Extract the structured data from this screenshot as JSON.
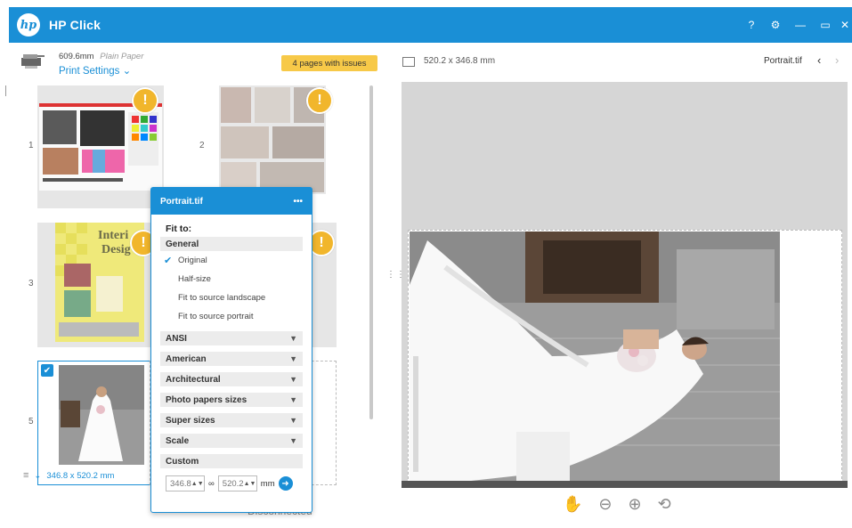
{
  "window": {
    "logo": "hp",
    "title": "HP Click",
    "controls": {
      "help": "?",
      "settings": "⚙",
      "minimize": "—",
      "maximize": "▭",
      "close": "✕"
    }
  },
  "printer": {
    "paper_size": "609.6mm",
    "paper_type": "Plain Paper",
    "settings_label": "Print Settings"
  },
  "issues_badge": "4 pages with issues",
  "thumbnails": [
    {
      "number": "1",
      "has_warning": true
    },
    {
      "number": "2",
      "has_warning": true
    },
    {
      "number": "3",
      "has_warning": true
    },
    {
      "number": "5",
      "has_warning": false,
      "selected": true,
      "size": "346.8 x 520.2 mm"
    }
  ],
  "status": "Disconnected",
  "popup": {
    "title": "Portrait.tif",
    "menu": "•••",
    "fit_to_label": "Fit to:",
    "general_label": "General",
    "general_options": [
      {
        "label": "Original",
        "selected": true
      },
      {
        "label": "Half-size",
        "selected": false
      },
      {
        "label": "Fit to source landscape",
        "selected": false
      },
      {
        "label": "Fit to source portrait",
        "selected": false
      }
    ],
    "sections": [
      "ANSI",
      "American",
      "Architectural",
      "Photo papers sizes",
      "Super sizes",
      "Scale"
    ],
    "custom_label": "Custom",
    "custom_width": "346.8",
    "custom_link": "∞",
    "custom_height": "520.2",
    "custom_unit": "mm"
  },
  "preview": {
    "size": "520.2 x 346.8 mm",
    "file_name": "Portrait.tif",
    "prev": "‹",
    "next": "›",
    "tools": {
      "pan": "✋",
      "zoom_out": "⊖",
      "zoom_in": "⊕",
      "rotate": "⟲"
    }
  }
}
